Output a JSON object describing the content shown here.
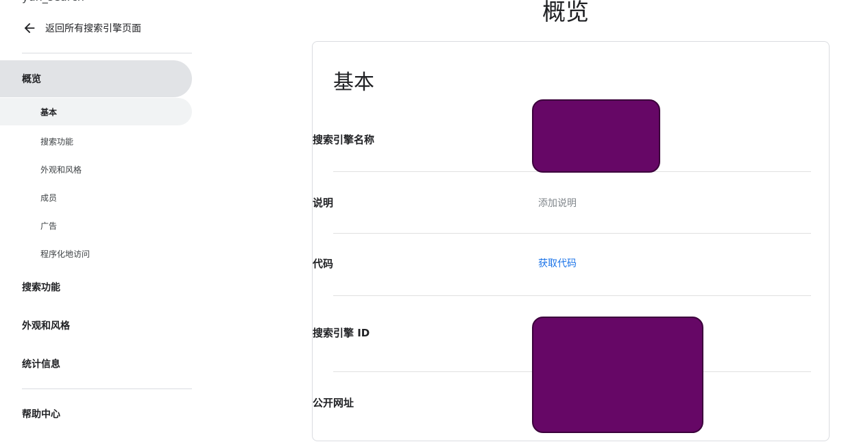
{
  "sidebar": {
    "engine_name": "yun_search",
    "back_label": "返回所有搜索引擎页面",
    "nav_overview": "概览",
    "sub_items": [
      {
        "label": "基本"
      },
      {
        "label": "搜索功能"
      },
      {
        "label": "外观和风格"
      },
      {
        "label": "成员"
      },
      {
        "label": "广告"
      },
      {
        "label": "程序化地访问"
      }
    ],
    "nav_search_features": "搜索功能",
    "nav_look_feel": "外观和风格",
    "nav_stats": "统计信息",
    "nav_help": "帮助中心"
  },
  "main": {
    "page_title": "概览",
    "card_title": "基本",
    "rows": {
      "name_label": "搜索引擎名称",
      "desc_label": "说明",
      "desc_placeholder": "添加说明",
      "code_label": "代码",
      "code_link": "获取代码",
      "id_label": "搜索引擎 ID",
      "url_label": "公开网址"
    }
  },
  "colors": {
    "redaction": "#660766",
    "link": "#1a73e8",
    "active_nav_bg": "#e1e3e6"
  }
}
